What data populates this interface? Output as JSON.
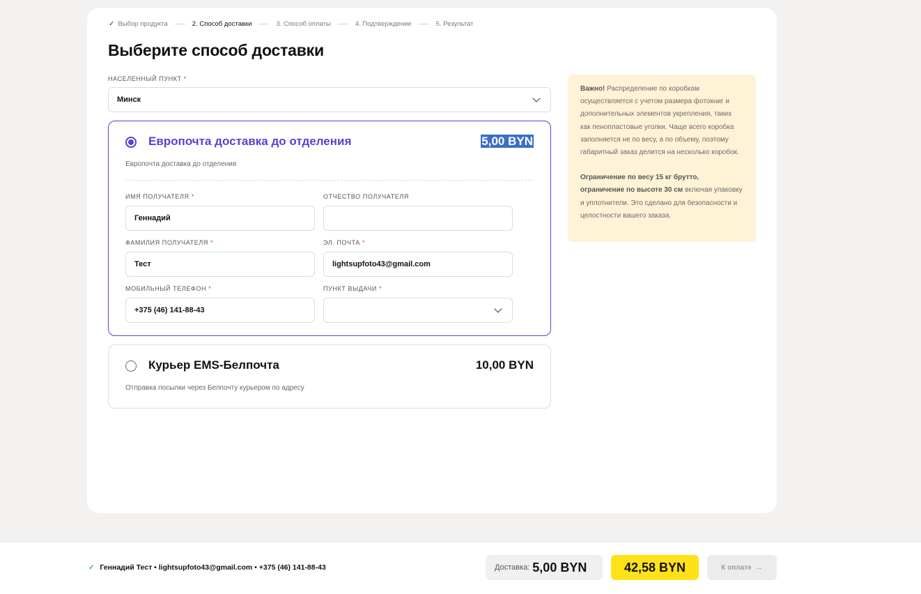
{
  "stepper": {
    "steps": [
      {
        "label": "Выбор продукта",
        "state": "done"
      },
      {
        "label": "2. Способ доставки",
        "state": "active"
      },
      {
        "label": "3. Способ оплаты",
        "state": "pending"
      },
      {
        "label": "4. Подтверждение",
        "state": "pending"
      },
      {
        "label": "5. Результат",
        "state": "pending"
      }
    ]
  },
  "page_title": "Выберите способ доставки",
  "city": {
    "label": "НАСЕЛЕННЫЙ ПУНКТ",
    "required_mark": "*",
    "value": "Минск"
  },
  "options": [
    {
      "name": "Европочта доставка до отделения",
      "price": "5,00 BYN",
      "description": "Европочта доставка до отделения",
      "selected": true
    },
    {
      "name": "Курьер EMS-Белпочта",
      "price": "10,00 BYN",
      "description": "Отправка посылки через Белпочту курьером по адресу",
      "selected": false
    }
  ],
  "form": {
    "first_name": {
      "label": "ИМЯ ПОЛУЧАТЕЛЯ",
      "value": "Геннадий",
      "required": true
    },
    "patronymic": {
      "label": "ОТЧЕСТВО ПОЛУЧАТЕЛЯ",
      "value": "",
      "required": false
    },
    "last_name": {
      "label": "ФАМИЛИЯ ПОЛУЧАТЕЛЯ",
      "value": "Тест",
      "required": true
    },
    "email": {
      "label": "ЭЛ. ПОЧТА",
      "value": "lightsupfoto43@gmail.com",
      "required": true
    },
    "phone": {
      "label": "МОБИЛЬНЫЙ ТЕЛЕФОН",
      "value": "+375 (46) 141-88-43",
      "required": true
    },
    "pickup_point": {
      "label": "ПУНКТ ВЫДАЧИ",
      "value": "",
      "required": true
    }
  },
  "notice": {
    "p1_bold": "Важно!",
    "p1_text": " Распределение по коробкам осуществляется с учетом размера фотокниг и дополнительных элементов укрепления, таких как пенопластовые уголки. Чаще всего коробка заполняется не по весу, а по объему, поэтому габаритный заказ делится на несколько коробок.",
    "p2_bold": "Ограничение по весу 15 кг брутто, ограничение по высоте 30 см",
    "p2_text": " включая упаковку и уплотнители. Это сделано для безопасности и целостности вашего заказа."
  },
  "footer": {
    "summary": "Геннадий Тест • lightsupfoto43@gmail.com • +375 (46) 141-88-43",
    "delivery_label": "Доставка:",
    "delivery_value": "5,00 BYN",
    "total": "42,58 BYN",
    "pay_label": "К оплате"
  },
  "colors": {
    "accent": "#5b3fd0",
    "total_bg": "#ffe11a",
    "notice_bg": "#fef3d6",
    "required": "#ee3333"
  }
}
